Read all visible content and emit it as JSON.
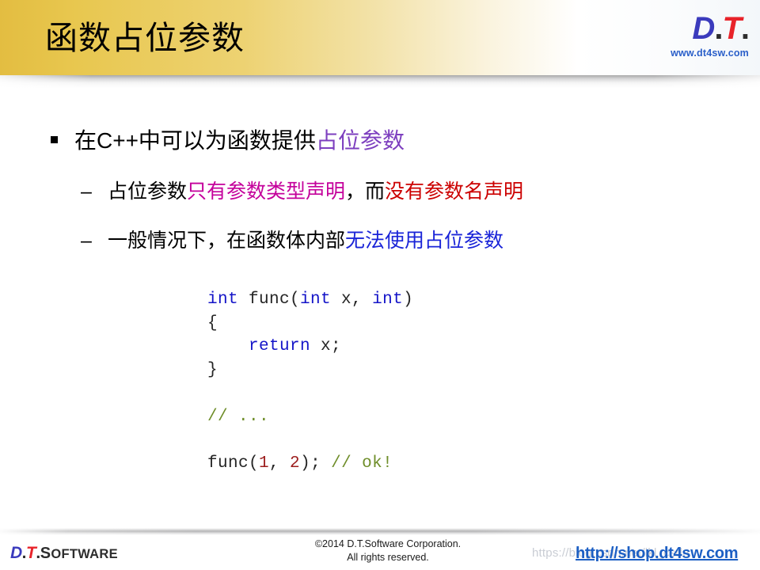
{
  "header": {
    "title": "函数占位参数",
    "logo": {
      "d": "D",
      "dot1": ".",
      "t": "T",
      "dot2": ".",
      "name": "D.T."
    },
    "url": "www.dt4sw.com",
    "gold_color": "#e8c74f"
  },
  "content": {
    "bullets": [
      {
        "marker": "square",
        "level": 1,
        "segments": [
          {
            "text": "在C++中可以为函数提供",
            "color": "#000000"
          },
          {
            "text": "占位参数",
            "color": "#7d3fbf"
          }
        ]
      },
      {
        "marker": "–",
        "level": 2,
        "segments": [
          {
            "text": "占位参数",
            "color": "#000000"
          },
          {
            "text": "只有参数类型声明",
            "color": "#c4009b"
          },
          {
            "text": "，而",
            "color": "#000000"
          },
          {
            "text": "没有参数名声明",
            "color": "#cc0000"
          }
        ]
      },
      {
        "marker": "–",
        "level": 2,
        "segments": [
          {
            "text": "一般情况下，在函数体内部",
            "color": "#000000"
          },
          {
            "text": "无法使用占位参数",
            "color": "#1a24d8"
          }
        ]
      }
    ],
    "code": {
      "lines": [
        [
          {
            "text": "int",
            "kind": "keyword"
          },
          {
            "text": " func(",
            "kind": "plain"
          },
          {
            "text": "int",
            "kind": "keyword"
          },
          {
            "text": " x, ",
            "kind": "plain"
          },
          {
            "text": "int",
            "kind": "keyword"
          },
          {
            "text": ")",
            "kind": "plain"
          }
        ],
        [
          {
            "text": "{",
            "kind": "plain"
          }
        ],
        [
          {
            "text": "    ",
            "kind": "plain"
          },
          {
            "text": "return",
            "kind": "keyword"
          },
          {
            "text": " x;",
            "kind": "plain"
          }
        ],
        [
          {
            "text": "}",
            "kind": "plain"
          }
        ],
        [
          {
            "text": "",
            "kind": "plain"
          }
        ],
        [
          {
            "text": "// ...",
            "kind": "comment"
          }
        ],
        [
          {
            "text": "",
            "kind": "plain"
          }
        ],
        [
          {
            "text": "func(",
            "kind": "plain"
          },
          {
            "text": "1",
            "kind": "number"
          },
          {
            "text": ", ",
            "kind": "plain"
          },
          {
            "text": "2",
            "kind": "number"
          },
          {
            "text": "); ",
            "kind": "plain"
          },
          {
            "text": "// ok!",
            "kind": "comment"
          }
        ]
      ]
    }
  },
  "footer": {
    "logo_d": "D",
    "logo_dot1": ".",
    "logo_t": "T",
    "logo_dot2": ".",
    "logo_word_cap": "S",
    "logo_word_rest": "OFTWARE",
    "copyright_line1": "©2014 D.T.Software Corporation.",
    "copyright_line2": "All rights reserved.",
    "watermark": "https://blog.csdn.net/lkl_csdn",
    "link": "http://shop.dt4sw.com"
  }
}
